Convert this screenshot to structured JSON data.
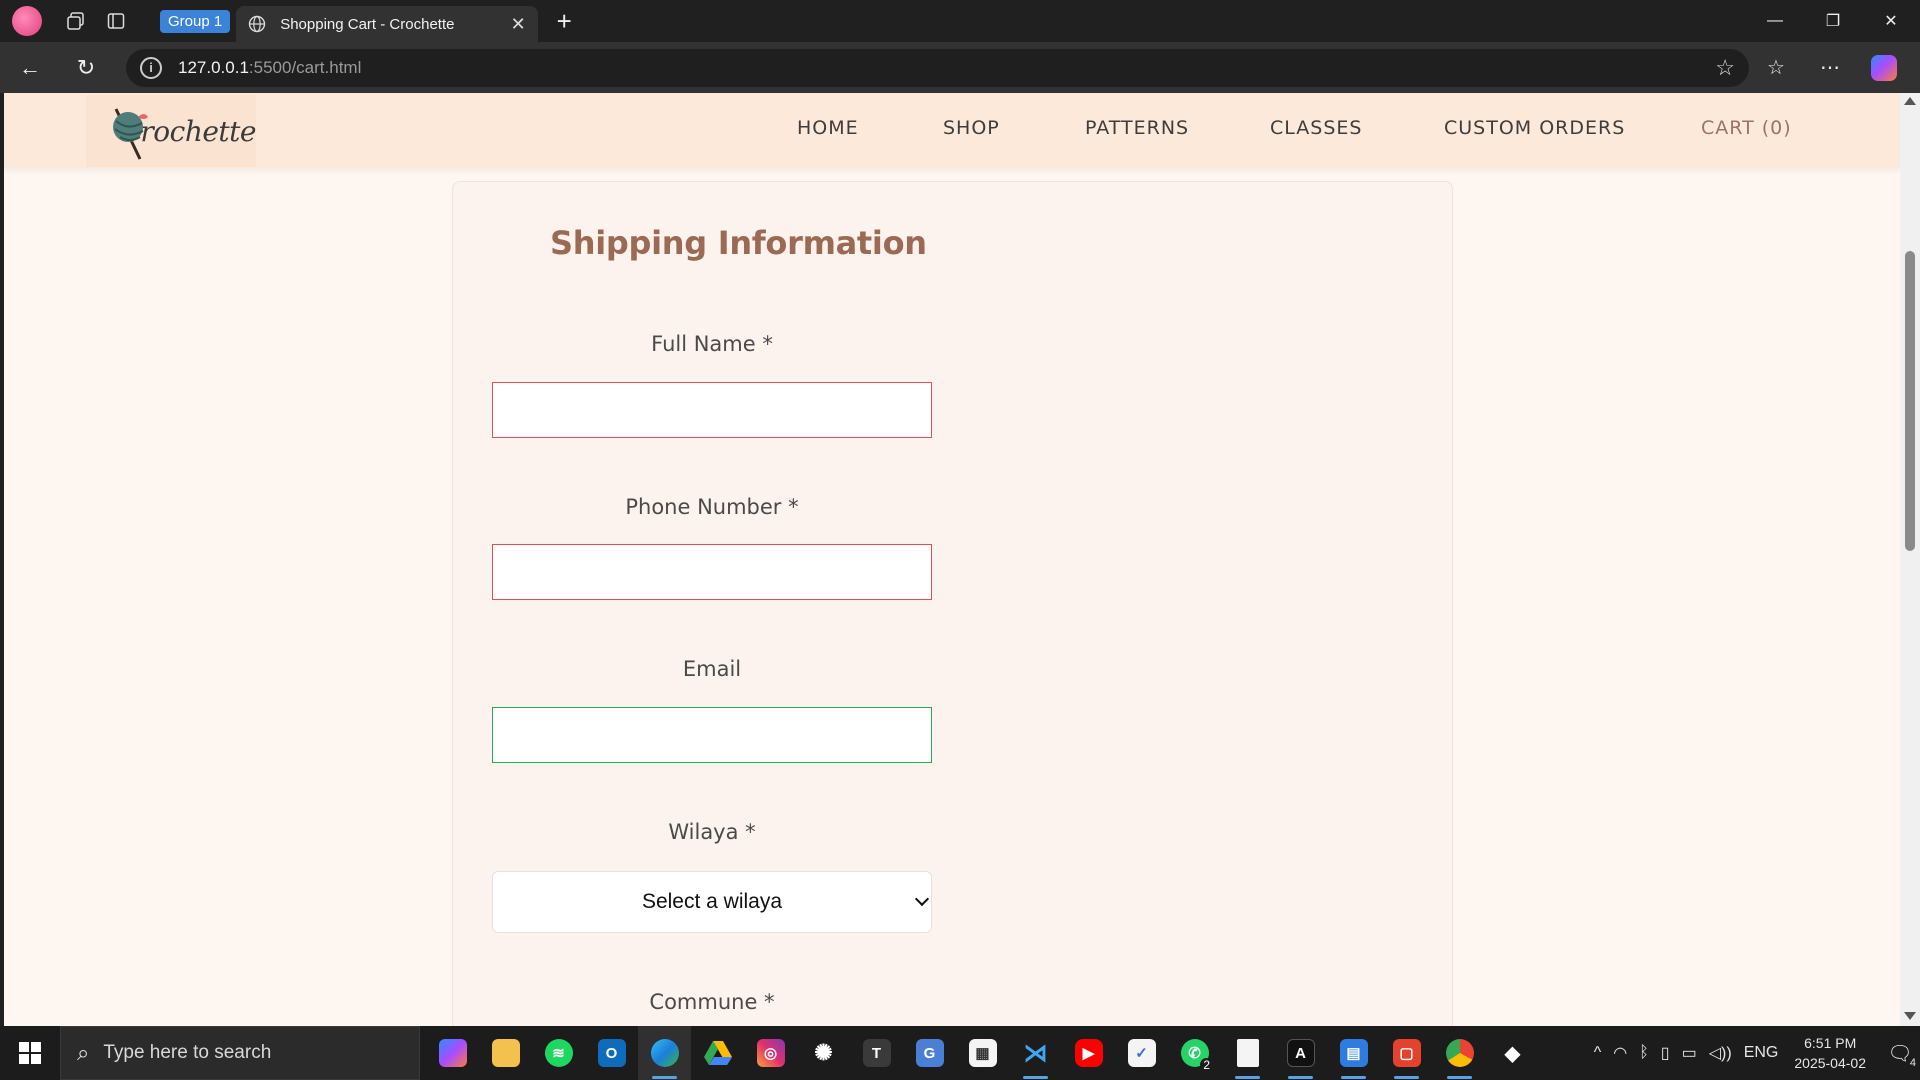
{
  "browser": {
    "group_label": "Group 1",
    "tab_title": "Shopping Cart - Crochette",
    "url_host": "127.0.0.1",
    "url_path": ":5500/cart.html"
  },
  "site": {
    "logo_text": "Crochette",
    "nav": {
      "home": "HOME",
      "shop": "SHOP",
      "patterns": "PATTERNS",
      "classes": "CLASSES",
      "custom_orders": "CUSTOM ORDERS",
      "cart": "CART (0)"
    },
    "colors": {
      "accent": "#9b6a55",
      "header_bg": "#fde9da",
      "invalid": "#e0505a",
      "valid": "#2fa85a"
    }
  },
  "shipping": {
    "title": "Shipping Information",
    "full_name_label": "Full Name *",
    "full_name_value": "",
    "phone_label": "Phone Number *",
    "phone_value": "",
    "email_label": "Email",
    "email_value": "",
    "wilaya_label": "Wilaya *",
    "wilaya_selected": "Select a wilaya",
    "commune_label": "Commune *"
  },
  "taskbar": {
    "search_placeholder": "Type here to search",
    "time": "6:51 PM",
    "date": "2025-04-02",
    "language": "ENG",
    "whatsapp_badge": "2",
    "notification_count": "4"
  }
}
